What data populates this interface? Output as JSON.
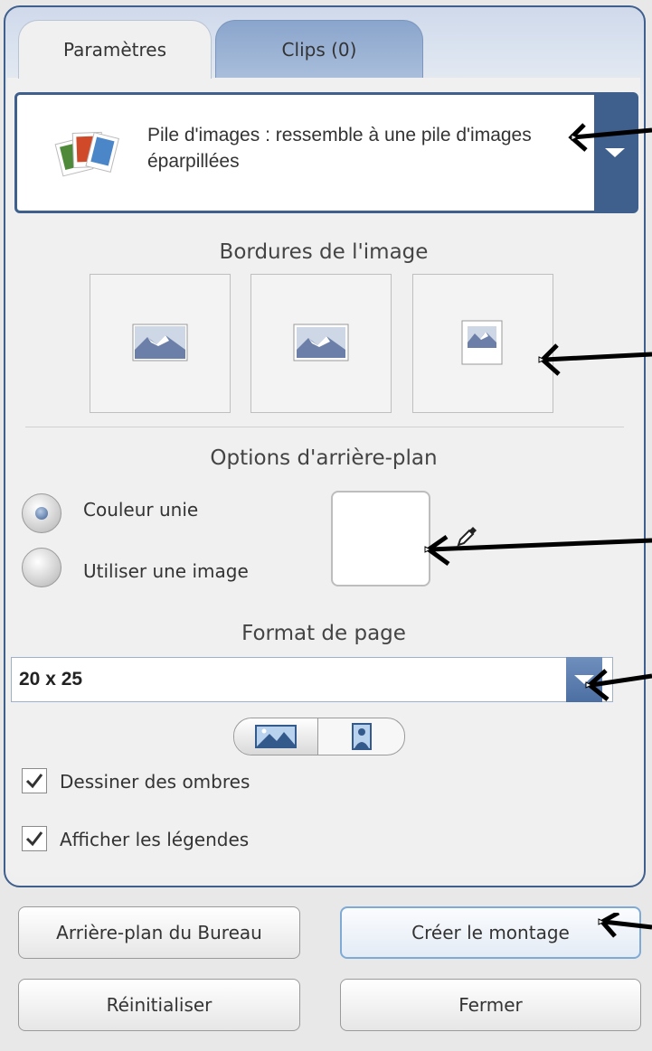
{
  "tabs": [
    {
      "label": "Paramètres",
      "active": true
    },
    {
      "label": "Clips (0)",
      "active": false
    }
  ],
  "style_select": {
    "label": "Pile d'images : ressemble à une pile d'images éparpillées",
    "icon": "photo-stack-icon"
  },
  "borders": {
    "title": "Bordures de l'image",
    "options": [
      "border-wide-icon",
      "border-medium-icon",
      "border-narrow-icon"
    ]
  },
  "background": {
    "title": "Options d'arrière-plan",
    "solid_color_label": "Couleur unie",
    "image_label": "Utiliser une image",
    "selected": "solid",
    "swatch_color": "#ffffff"
  },
  "page_format": {
    "title": "Format de page",
    "value": "20 x 25",
    "orientation": "landscape"
  },
  "checkboxes": [
    {
      "label": "Dessiner des ombres",
      "checked": true
    },
    {
      "label": "Afficher les légendes",
      "checked": true
    }
  ],
  "buttons": {
    "desktop_bg": "Arrière-plan du Bureau",
    "create": "Créer le montage",
    "reset": "Réinitialiser",
    "close": "Fermer"
  },
  "colors": {
    "accent": "#3f5f8c",
    "tab_inactive": "#98b1d4"
  }
}
